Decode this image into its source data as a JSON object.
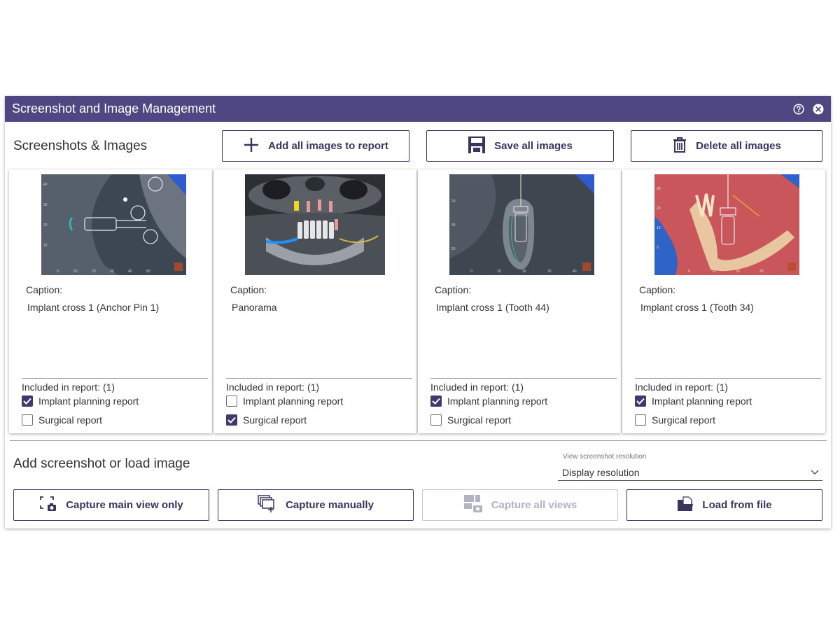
{
  "window": {
    "title": "Screenshot and Image Management",
    "help_icon": "help-circle-icon",
    "close_icon": "close-circle-icon"
  },
  "screenshots": {
    "section_title": "Screenshots & Images",
    "add_all_label": "Add all images to report",
    "save_all_label": "Save all images",
    "delete_all_label": "Delete all images"
  },
  "cards": [
    {
      "caption_label": "Caption:",
      "caption": "Implant cross 1 (Anchor Pin 1)",
      "included": "Included in report: (1)",
      "implant_label": "Implant planning report",
      "implant_checked": true,
      "surgical_label": "Surgical report",
      "surgical_checked": false
    },
    {
      "caption_label": "Caption:",
      "caption": "Panorama",
      "included": "Included in report: (1)",
      "implant_label": "Implant planning report",
      "implant_checked": false,
      "surgical_label": "Surgical report",
      "surgical_checked": true
    },
    {
      "caption_label": "Caption:",
      "caption": "Implant cross 1 (Tooth 44)",
      "included": "Included in report: (1)",
      "implant_label": "Implant planning report",
      "implant_checked": true,
      "surgical_label": "Surgical report",
      "surgical_checked": false
    },
    {
      "caption_label": "Caption:",
      "caption": "Implant cross 1 (Tooth 34)",
      "included": "Included in report: (1)",
      "implant_label": "Implant planning report",
      "implant_checked": true,
      "surgical_label": "Surgical report",
      "surgical_checked": false
    }
  ],
  "add_section": {
    "title": "Add screenshot or load image",
    "resolution_label": "View screenshot resolution",
    "resolution_value": "Display resolution",
    "capture_main_label": "Capture main view only",
    "capture_manual_label": "Capture manually",
    "capture_all_label": "Capture all views",
    "capture_all_enabled": false,
    "load_file_label": "Load from file"
  },
  "colors": {
    "accent": "#4f4781",
    "button_text": "#3a3560",
    "checkbox_on": "#3f3a6c",
    "disabled": "#b3b1c6"
  }
}
